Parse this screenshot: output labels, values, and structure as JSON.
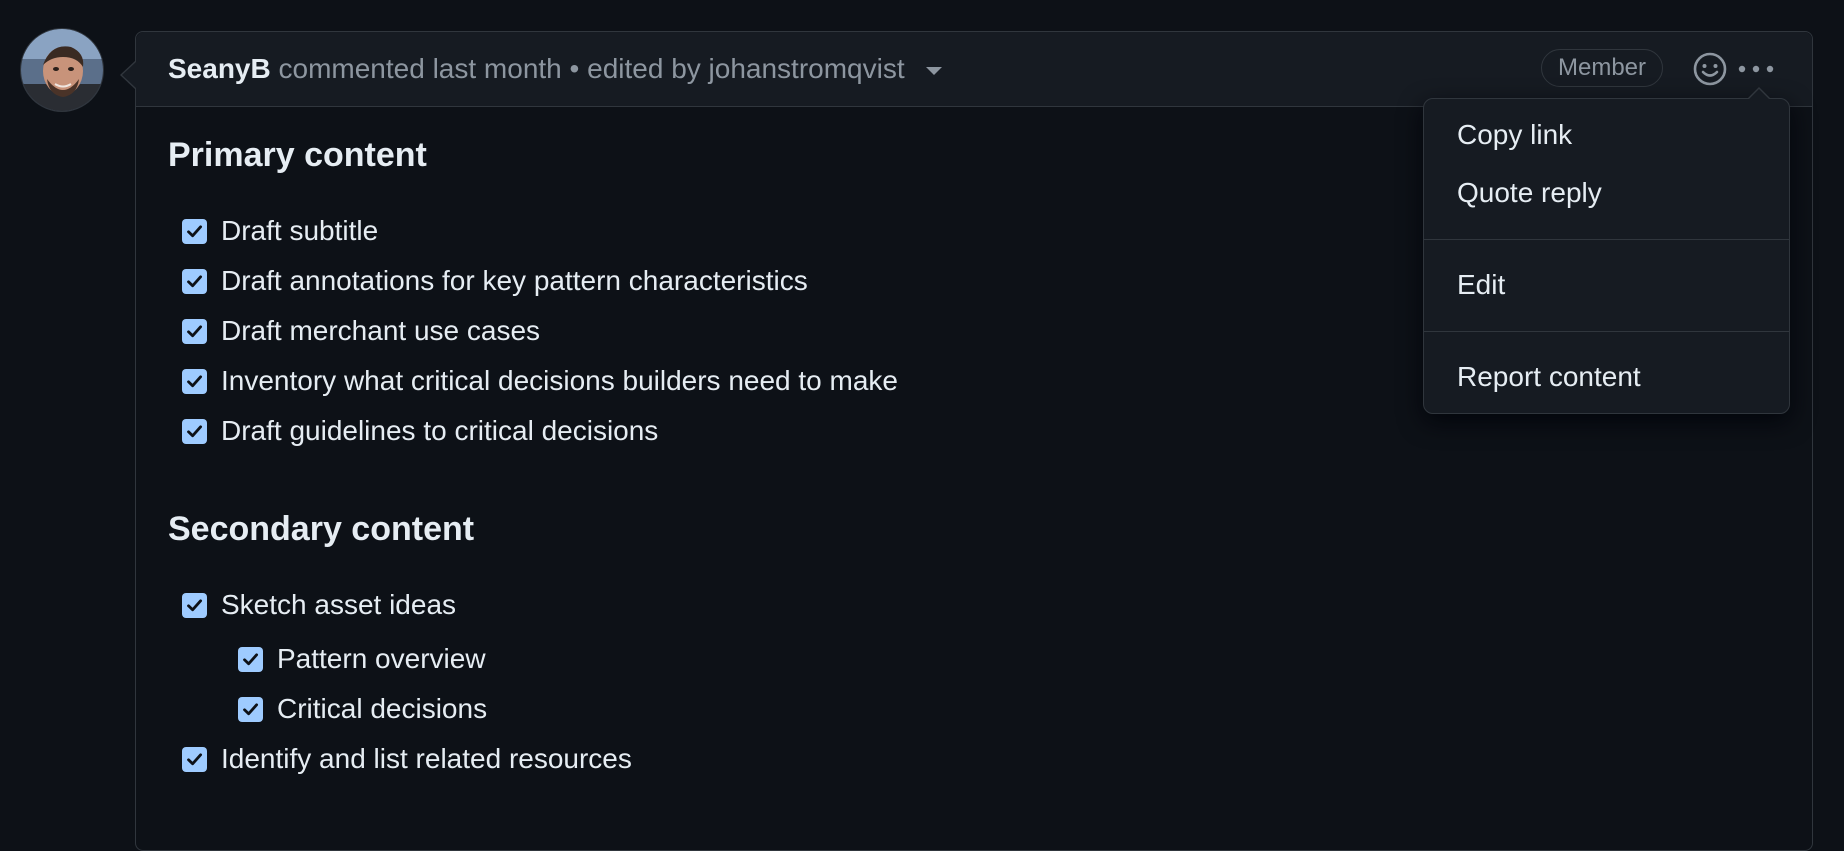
{
  "comment": {
    "author": "SeanyB",
    "action_text": "commented last month",
    "separator": "•",
    "edited_text": "edited by johanstromqvist",
    "badge": "Member",
    "icons": {
      "reaction": "smiley-icon",
      "more": "kebab-horizontal-icon",
      "edit_history": "triangle-down-icon"
    }
  },
  "primary": {
    "heading": "Primary content",
    "tasks": [
      {
        "label": "Draft subtitle",
        "checked": true
      },
      {
        "label": "Draft annotations for key pattern characteristics",
        "checked": true
      },
      {
        "label": "Draft merchant use cases",
        "checked": true
      },
      {
        "label": "Inventory what critical decisions builders need to make",
        "checked": true
      },
      {
        "label": "Draft guidelines to critical decisions",
        "checked": true
      }
    ]
  },
  "secondary": {
    "heading": "Secondary content",
    "tasks": [
      {
        "label": "Sketch asset ideas",
        "checked": true
      },
      {
        "label": "Pattern overview",
        "checked": true,
        "nested": true
      },
      {
        "label": "Critical decisions",
        "checked": true,
        "nested": true
      },
      {
        "label": "Identify and list related resources",
        "checked": true
      }
    ]
  },
  "menu": {
    "copy_link": "Copy link",
    "quote_reply": "Quote reply",
    "edit": "Edit",
    "report": "Report content"
  },
  "colors": {
    "background": "#0d1117",
    "header_bg": "#161b22",
    "border": "#30363d",
    "muted_text": "#8d96a0",
    "text": "#e6edf3",
    "checkbox": "#9ecbff"
  }
}
